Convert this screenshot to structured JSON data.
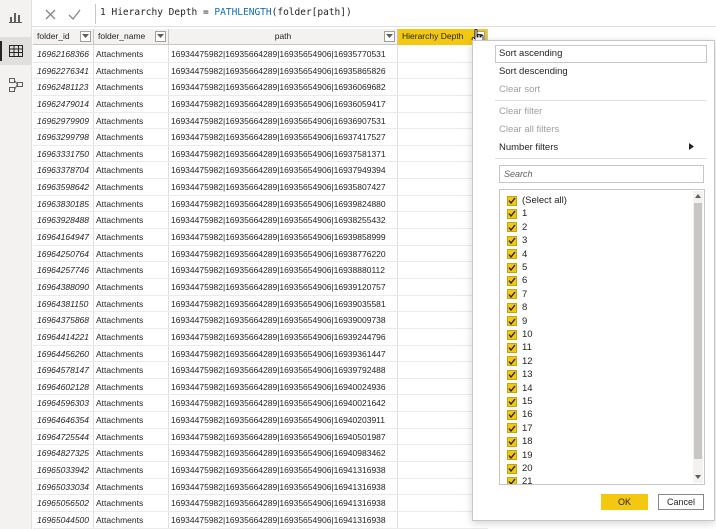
{
  "rail": {
    "items": [
      {
        "icon": "report-view-icon"
      },
      {
        "icon": "data-view-icon"
      },
      {
        "icon": "model-view-icon"
      }
    ]
  },
  "formula": {
    "line_number": "1",
    "name_part": "Hierarchy Depth = ",
    "function_part": "PATHLENGTH",
    "args_part": "(folder[path])"
  },
  "table": {
    "columns": [
      "folder_id",
      "folder_name",
      "path",
      "Hierarchy Depth"
    ],
    "rows": [
      {
        "folder_id": "16962168366",
        "folder_name": "Attachments",
        "path": "16934475982|16935664289|16935654906|16935770531",
        "depth": ""
      },
      {
        "folder_id": "16962276341",
        "folder_name": "Attachments",
        "path": "16934475982|16935664289|16935654906|16935865826",
        "depth": ""
      },
      {
        "folder_id": "16962481123",
        "folder_name": "Attachments",
        "path": "16934475982|16935664289|16935654906|16936069682",
        "depth": ""
      },
      {
        "folder_id": "16962479014",
        "folder_name": "Attachments",
        "path": "16934475982|16935664289|16935654906|16936059417",
        "depth": ""
      },
      {
        "folder_id": "16962979909",
        "folder_name": "Attachments",
        "path": "16934475982|16935664289|16935654906|16936907531",
        "depth": ""
      },
      {
        "folder_id": "16963299798",
        "folder_name": "Attachments",
        "path": "16934475982|16935664289|16935654906|16937417527",
        "depth": ""
      },
      {
        "folder_id": "16963331750",
        "folder_name": "Attachments",
        "path": "16934475982|16935664289|16935654906|16937581371",
        "depth": ""
      },
      {
        "folder_id": "16963378704",
        "folder_name": "Attachments",
        "path": "16934475982|16935664289|16935654906|16937949394",
        "depth": ""
      },
      {
        "folder_id": "16963598642",
        "folder_name": "Attachments",
        "path": "16934475982|16935664289|16935654906|16935807427",
        "depth": ""
      },
      {
        "folder_id": "16963830185",
        "folder_name": "Attachments",
        "path": "16934475982|16935664289|16935654906|16939824880",
        "depth": ""
      },
      {
        "folder_id": "16963928488",
        "folder_name": "Attachments",
        "path": "16934475982|16935664289|16935654906|16938255432",
        "depth": ""
      },
      {
        "folder_id": "16964164947",
        "folder_name": "Attachments",
        "path": "16934475982|16935664289|16935654906|16939858999",
        "depth": ""
      },
      {
        "folder_id": "16964250764",
        "folder_name": "Attachments",
        "path": "16934475982|16935664289|16935654906|16938776220",
        "depth": ""
      },
      {
        "folder_id": "16964257746",
        "folder_name": "Attachments",
        "path": "16934475982|16935664289|16935654906|16938880112",
        "depth": ""
      },
      {
        "folder_id": "16964388090",
        "folder_name": "Attachments",
        "path": "16934475982|16935664289|16935654906|16939120757",
        "depth": ""
      },
      {
        "folder_id": "16964381150",
        "folder_name": "Attachments",
        "path": "16934475982|16935664289|16935654906|16939035581",
        "depth": ""
      },
      {
        "folder_id": "16964375868",
        "folder_name": "Attachments",
        "path": "16934475982|16935664289|16935654906|16939009738",
        "depth": ""
      },
      {
        "folder_id": "16964414221",
        "folder_name": "Attachments",
        "path": "16934475982|16935664289|16935654906|16939244796",
        "depth": ""
      },
      {
        "folder_id": "16964456260",
        "folder_name": "Attachments",
        "path": "16934475982|16935664289|16935654906|16939361447",
        "depth": ""
      },
      {
        "folder_id": "16964578147",
        "folder_name": "Attachments",
        "path": "16934475982|16935664289|16935654906|16939792488",
        "depth": ""
      },
      {
        "folder_id": "16964602128",
        "folder_name": "Attachments",
        "path": "16934475982|16935664289|16935654906|16940024936",
        "depth": ""
      },
      {
        "folder_id": "16964596303",
        "folder_name": "Attachments",
        "path": "16934475982|16935664289|16935654906|16940021642",
        "depth": ""
      },
      {
        "folder_id": "16964646354",
        "folder_name": "Attachments",
        "path": "16934475982|16935664289|16935654906|16940203911",
        "depth": ""
      },
      {
        "folder_id": "16964725544",
        "folder_name": "Attachments",
        "path": "16934475982|16935664289|16935654906|16940501987",
        "depth": ""
      },
      {
        "folder_id": "16964827325",
        "folder_name": "Attachments",
        "path": "16934475982|16935664289|16935654906|16940983462",
        "depth": ""
      },
      {
        "folder_id": "16965033942",
        "folder_name": "Attachments",
        "path": "16934475982|16935664289|16935654906|16941316938",
        "depth": ""
      },
      {
        "folder_id": "16965033034",
        "folder_name": "Attachments",
        "path": "16934475982|16935664289|16935654906|16941316938",
        "depth": ""
      },
      {
        "folder_id": "16965056502",
        "folder_name": "Attachments",
        "path": "16934475982|16935664289|16935654906|16941316938",
        "depth": ""
      },
      {
        "folder_id": "16965044500",
        "folder_name": "Attachments",
        "path": "16934475982|16935664289|16935654906|16941316938",
        "depth": ""
      }
    ]
  },
  "filter_menu": {
    "sort_ascending": "Sort ascending",
    "sort_descending": "Sort descending",
    "clear_sort": "Clear sort",
    "clear_filter": "Clear filter",
    "clear_all_filters": "Clear all filters",
    "number_filters": "Number filters",
    "search_placeholder": "Search",
    "values": [
      "(Select all)",
      "1",
      "2",
      "3",
      "4",
      "5",
      "6",
      "7",
      "8",
      "9",
      "10",
      "11",
      "12",
      "13",
      "14",
      "15",
      "16",
      "17",
      "18",
      "19",
      "20",
      "21"
    ],
    "ok_label": "OK",
    "cancel_label": "Cancel"
  },
  "colors": {
    "accent": "#f2c811",
    "formula_function": "#0f6fb5"
  }
}
